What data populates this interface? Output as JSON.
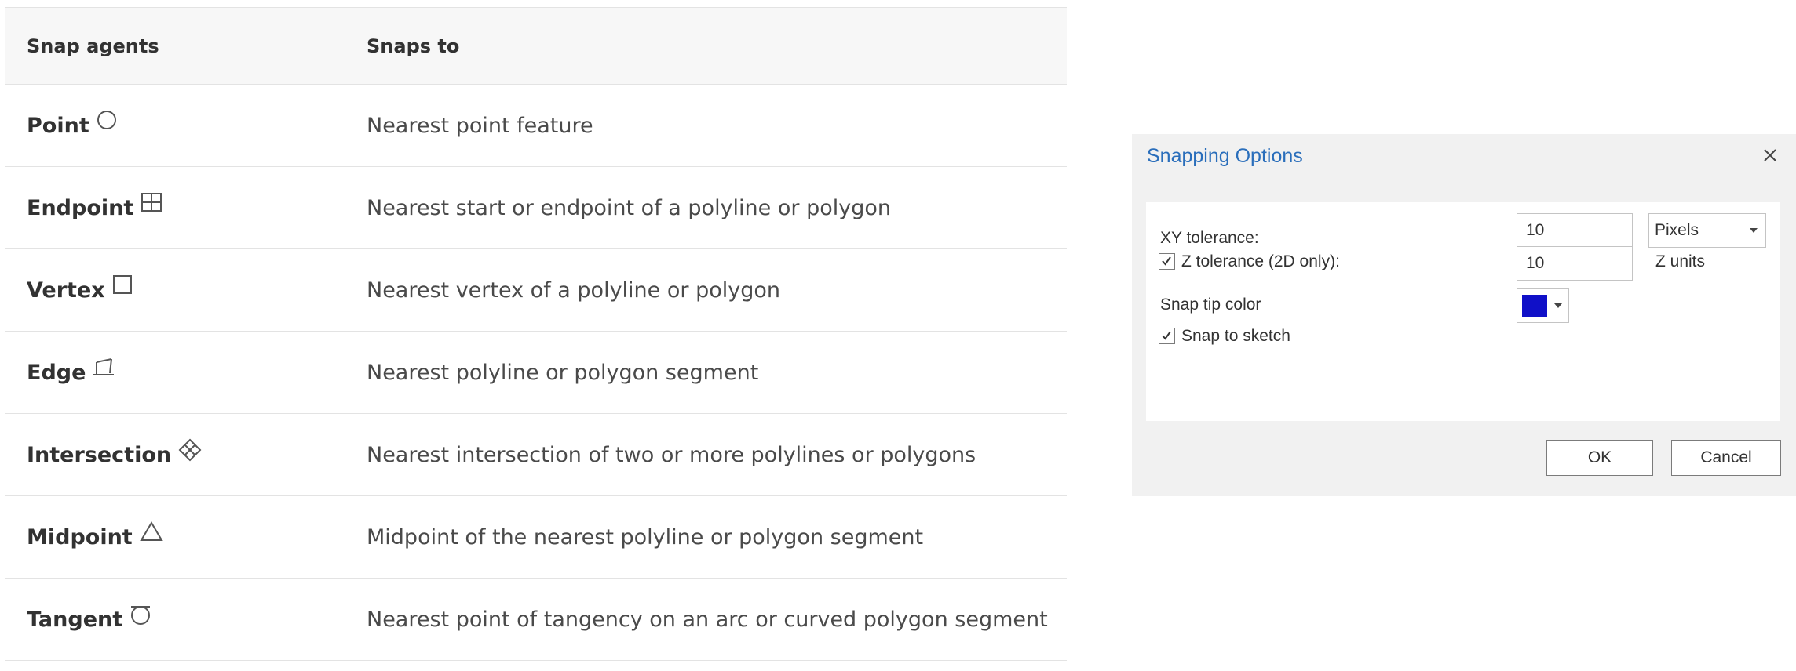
{
  "table": {
    "headers": {
      "agents": "Snap agents",
      "snaps_to": "Snaps to"
    },
    "rows": [
      {
        "agent": "Point",
        "icon": "circle-icon",
        "snaps_to": "Nearest point feature"
      },
      {
        "agent": "Endpoint",
        "icon": "grid-square-icon",
        "snaps_to": "Nearest start or endpoint of a polyline or polygon"
      },
      {
        "agent": "Vertex",
        "icon": "square-icon",
        "snaps_to": "Nearest vertex of a polyline or polygon"
      },
      {
        "agent": "Edge",
        "icon": "edge-icon",
        "snaps_to": "Nearest polyline or polygon segment"
      },
      {
        "agent": "Intersection",
        "icon": "intersection-diamond-icon",
        "snaps_to": "Nearest intersection of two or more polylines or polygons"
      },
      {
        "agent": "Midpoint",
        "icon": "triangle-icon",
        "snaps_to": "Midpoint of the nearest polyline or polygon segment"
      },
      {
        "agent": "Tangent",
        "icon": "tangent-icon",
        "snaps_to": "Nearest point of tangency on an arc or curved polygon segment"
      }
    ]
  },
  "dialog": {
    "title": "Snapping Options",
    "xy_tolerance": {
      "label": "XY tolerance:",
      "value": "10",
      "unit": "Pixels"
    },
    "z_tolerance": {
      "label": "Z tolerance (2D only):",
      "checked": true,
      "value": "10",
      "unit": "Z units"
    },
    "snap_tip_color": {
      "label": "Snap tip color",
      "color": "#1010c8"
    },
    "snap_to_sketch": {
      "label": "Snap to sketch",
      "checked": true
    },
    "ok_label": "OK",
    "cancel_label": "Cancel"
  },
  "colors": {
    "dialog_title": "#2a6ebb",
    "header_bg": "#f7f7f7",
    "dialog_bg": "#f1f1f1"
  }
}
